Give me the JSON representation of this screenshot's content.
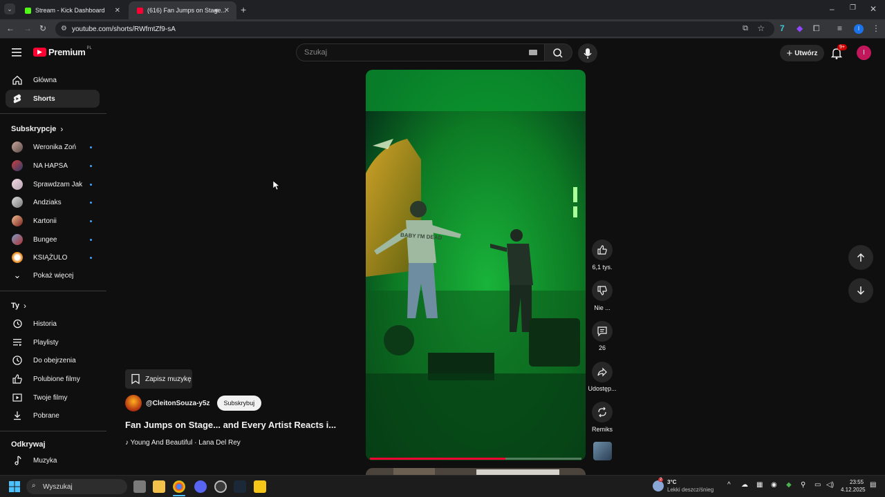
{
  "browser": {
    "tabs": [
      {
        "title": "Stream - Kick Dashboard"
      },
      {
        "title": "(616) Fan Jumps on Stage..."
      }
    ],
    "url": "youtube.com/shorts/RWfmtZf9-sA"
  },
  "header": {
    "logo": "Premium",
    "region": "PL",
    "search_placeholder": "Szukaj",
    "create_label": "Utwórz",
    "notif_count": "9+",
    "avatar_letter": "I"
  },
  "sidebar": {
    "home": "Główna",
    "shorts": "Shorts",
    "subs_header": "Subskrypcje",
    "subscriptions": [
      {
        "name": "Weronika Zoń"
      },
      {
        "name": "NA HAPSA"
      },
      {
        "name": "Sprawdzam Jak"
      },
      {
        "name": "Andziaks"
      },
      {
        "name": "Kartonii"
      },
      {
        "name": "Bungee"
      },
      {
        "name": "KSIĄŻULO"
      }
    ],
    "show_more": "Pokaż więcej",
    "you_header": "Ty",
    "you_items": [
      {
        "label": "Historia"
      },
      {
        "label": "Playlisty"
      },
      {
        "label": "Do obejrzenia"
      },
      {
        "label": "Polubione filmy"
      },
      {
        "label": "Twoje filmy"
      },
      {
        "label": "Pobrane"
      }
    ],
    "explore_header": "Odkrywaj",
    "explore_items": [
      {
        "label": "Muzyka"
      }
    ]
  },
  "short": {
    "save_music": "Zapisz muzykę",
    "channel": "@CleitonSouza-y5z",
    "subscribe": "Subskrybuj",
    "title": "Fan Jumps on Stage... and Every Artist Reacts i...",
    "music": "Young And Beautiful · Lana Del Rey",
    "progress": 0.64,
    "video_text": "BABY I'M DEAD"
  },
  "actions": {
    "likes": "6,1 tys.",
    "dislike": "Nie ...",
    "comments": "26",
    "share": "Udostęp...",
    "remix": "Remiks"
  },
  "taskbar": {
    "search": "Wyszukaj",
    "weather_temp": "3°C",
    "weather_desc": "Lekki deszcz/śnieg",
    "time": "23:55",
    "date": "4.12.2025",
    "weather_badge": "2"
  }
}
